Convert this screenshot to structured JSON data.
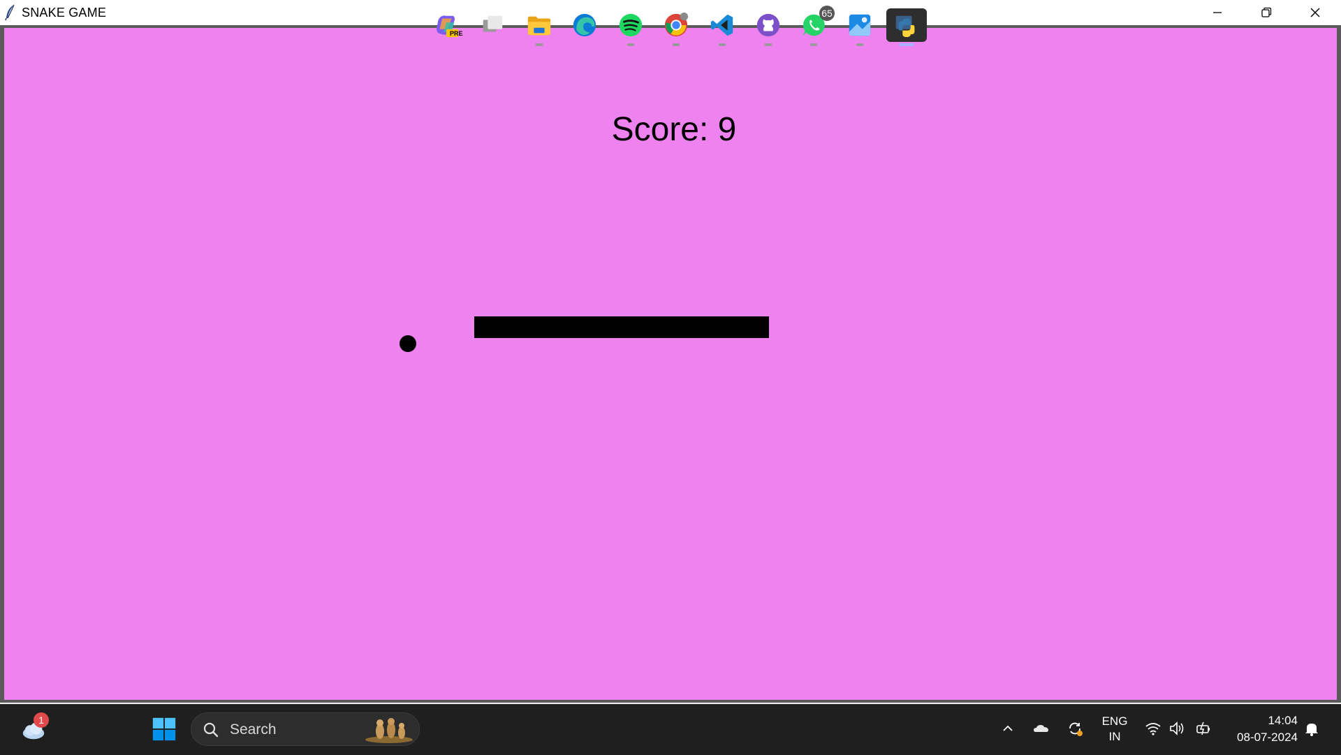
{
  "window": {
    "title": "SNAKE GAME",
    "controls": {
      "minimize": "minimize-icon",
      "maximize": "restore-icon",
      "close": "close-icon"
    }
  },
  "game": {
    "background_color": "#ee82ee",
    "score_text": "Score: 9",
    "snake_color": "#000000",
    "food_color": "#000000"
  },
  "taskbar": {
    "weather_badge": "1",
    "search_placeholder": "Search",
    "pinned_apps": [
      {
        "name": "copilot",
        "icon": "copilot-icon",
        "label": "PRE"
      },
      {
        "name": "task-view",
        "icon": "task-view-icon"
      },
      {
        "name": "file-explorer",
        "icon": "folder-icon",
        "running": true
      },
      {
        "name": "edge",
        "icon": "edge-icon"
      },
      {
        "name": "spotify",
        "icon": "spotify-icon",
        "running": true
      },
      {
        "name": "chrome",
        "icon": "chrome-icon",
        "running": true
      },
      {
        "name": "vscode",
        "icon": "vscode-icon",
        "running": true
      },
      {
        "name": "github-desktop",
        "icon": "github-icon",
        "running": true
      },
      {
        "name": "whatsapp",
        "icon": "whatsapp-icon",
        "badge": "65",
        "running": true
      },
      {
        "name": "photos",
        "icon": "photos-icon",
        "running": true
      },
      {
        "name": "python",
        "icon": "python-icon",
        "running": true,
        "active": true
      }
    ],
    "tray": {
      "language_line1": "ENG",
      "language_line2": "IN",
      "time": "14:04",
      "date": "08-07-2024"
    }
  }
}
